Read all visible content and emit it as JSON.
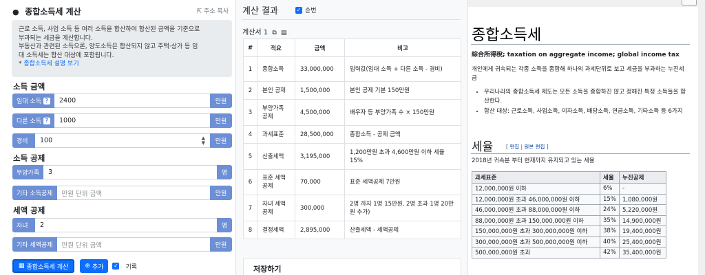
{
  "left": {
    "title": "종합소득세 계산",
    "title_icon": "coins-icon",
    "address_copy": "주소 복사",
    "info": {
      "line1": "근로 소득, 사업 소득 등 여러 소득을 합산하여 합산된 금액을 기준으로",
      "line2": "부과되는 세금을 계산합니다.",
      "line3": "부동산과 관련된 소득으론, 양도소득은 합산되지 않고 주택·상가 등 임",
      "line4": "대 소득세는 합산 대상에 포함됩니다.",
      "link": "종합소득세 설명 보기"
    },
    "income_section": "소득 금액",
    "rent_label": "임대 소득",
    "rent_value": "2400",
    "rent_unit": "만원",
    "other_label": "다른 소득",
    "other_value": "1000",
    "other_unit": "만원",
    "expense_label": "경비",
    "expense_value": "100",
    "expense_unit": "만원",
    "deduction_section": "소득 공제",
    "dependents_label": "부양가족",
    "dependents_value": "3",
    "dependents_unit": "명",
    "other_ded_label": "기타 소득공제",
    "other_ded_placeholder": "만원 단위 금액",
    "other_ded_unit": "만원",
    "tax_ded_section": "세액 공제",
    "children_label": "자녀",
    "children_value": "2",
    "children_unit": "명",
    "other_taxded_label": "기타 세액공제",
    "other_taxded_placeholder": "만원 단위 금액",
    "other_taxded_unit": "만원",
    "calc_button": "종합소득세 계산",
    "add_button": "추가",
    "record_label": "기록"
  },
  "mid": {
    "title": "계산 결과",
    "seq_label": "순번",
    "calc_title": "계산서 1",
    "headers": [
      "#",
      "적요",
      "금액",
      "비고"
    ],
    "rows": [
      {
        "n": "1",
        "item": "종합소득",
        "amount": "33,000,000",
        "note": "입력값(임대 소득 + 다른 소득 - 경비)"
      },
      {
        "n": "2",
        "item": "본인 공제",
        "amount": "1,500,000",
        "note": "본인 공제 기본 150만원"
      },
      {
        "n": "3",
        "item": "부양가족 공제",
        "amount": "4,500,000",
        "note": "배우자 등 부양가족 수 × 150만원"
      },
      {
        "n": "4",
        "item": "과세표준",
        "amount": "28,500,000",
        "note": "종합소득 - 공제 금액"
      },
      {
        "n": "5",
        "item": "산출세액",
        "amount": "3,195,000",
        "note": "1,200만원 초과 4,600만원 이하 세율 15%"
      },
      {
        "n": "6",
        "item": "표준 세액 공제",
        "amount": "70,000",
        "note": "표준 세액공제 7만원"
      },
      {
        "n": "7",
        "item": "자녀 세액 공제",
        "amount": "300,000",
        "note": "2명 까지 1명 15만원, 2명 초과 1명 20만원 추가)"
      },
      {
        "n": "8",
        "item": "결정세액",
        "amount": "2,895,000",
        "note": "산출세액 - 세액공제"
      }
    ],
    "save_title": "저장하기"
  },
  "right": {
    "title": "종합소득세",
    "subtitle": "綜合所得稅; taxation on aggregate income; global income tax",
    "para": "개인에게 귀속되는 각종 소득을 종합해 하나의 과세단위로 보고 세금을 부과하는 누진세금",
    "bullet1": "우리나라의 종합소득세 제도는 모든 소득을 종합하진 않고 정해진 특정 소득들을 합산한다.",
    "bullet2": "합산 대상: 근로소득, 사업소득, 이자소득, 배당소득, 연금소득, 기타소득 등 6가지",
    "section": "세율",
    "edit1": "편집",
    "edit2": "원본 편집",
    "section_para": "2018년 귀속분 부터 현재까지 유지되고 있는 세율",
    "tax_headers": [
      "과세표준",
      "세율",
      "누진공제"
    ],
    "tax_rows": [
      [
        "12,000,000원 이하",
        "6%",
        "-"
      ],
      [
        "12,000,000원 초과 46,000,000원 이하",
        "15%",
        "1,080,000원"
      ],
      [
        "46,000,000원 초과 88,000,000원 이하",
        "24%",
        "5,220,000원"
      ],
      [
        "88,000,000원 초과 150,000,000원 이하",
        "35%",
        "14,900,000원"
      ],
      [
        "150,000,000원 초과 300,000,000원 이하",
        "38%",
        "19,400,000원"
      ],
      [
        "300,000,000원 초과 500,000,000원 이하",
        "40%",
        "25,400,000원"
      ],
      [
        "500,000,000원 초과",
        "42%",
        "35,400,000원"
      ]
    ]
  }
}
